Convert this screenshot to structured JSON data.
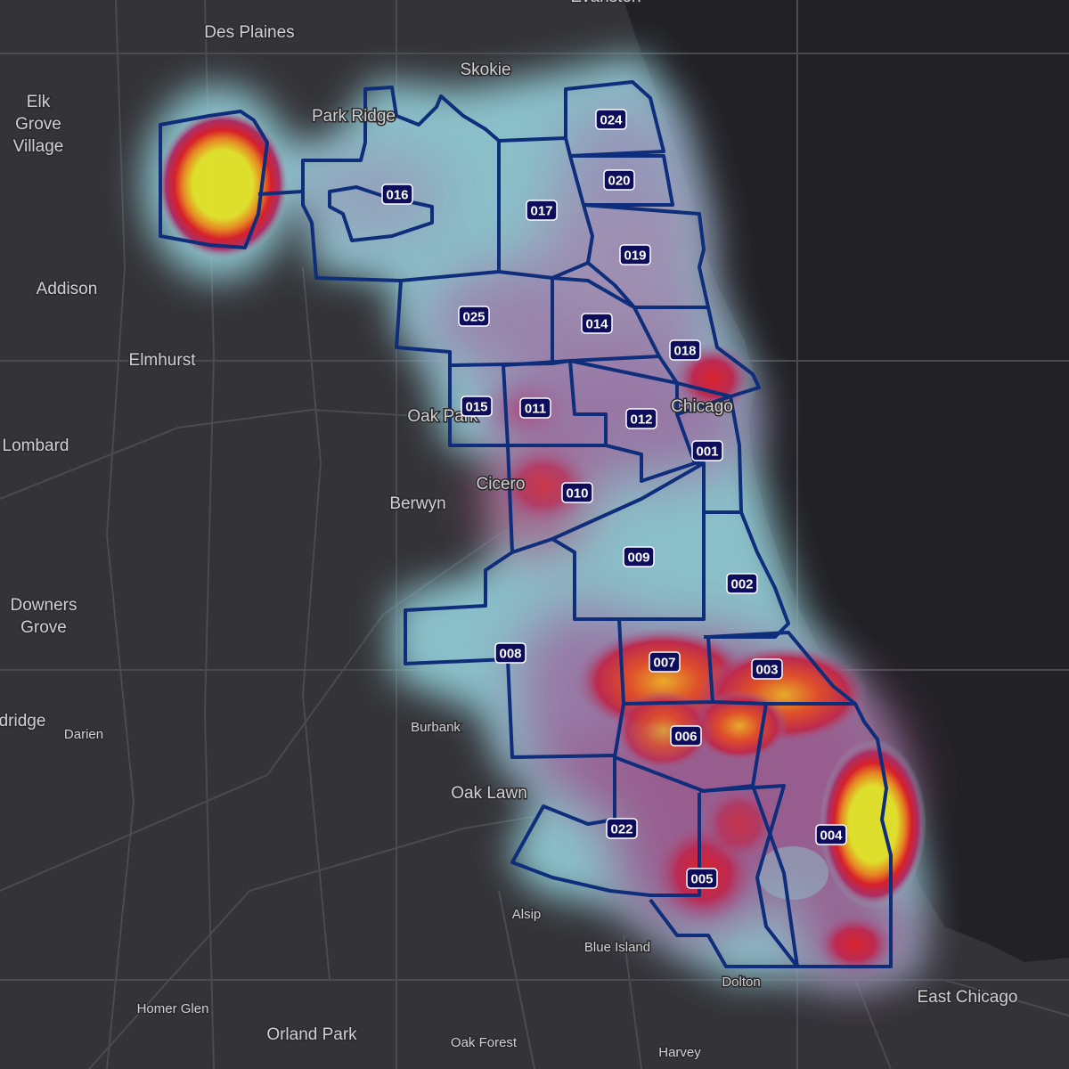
{
  "map": {
    "water_color": "#222226",
    "land_color": "#343438",
    "heat_base_color": "#8fc7d1",
    "heat_colors": [
      "#8fc7d1",
      "#9a6fa3",
      "#c0305a",
      "#e0202a",
      "#f5a020",
      "#e6e62a"
    ],
    "boundary_color": "#0e2d7a"
  },
  "places": [
    {
      "name": "Evanston"
    },
    {
      "name": "Des Plaines"
    },
    {
      "name": "Skokie"
    },
    {
      "name": "Elk\nGrove\nVillage"
    },
    {
      "name": "Park Ridge"
    },
    {
      "name": "Addison"
    },
    {
      "name": "Elmhurst"
    },
    {
      "name": "Oak Park"
    },
    {
      "name": "Chicago"
    },
    {
      "name": "Lombard"
    },
    {
      "name": "Cicero"
    },
    {
      "name": "Berwyn"
    },
    {
      "name": "Downers\nGrove"
    },
    {
      "name": "dridge"
    },
    {
      "name": "Darien"
    },
    {
      "name": "Burbank"
    },
    {
      "name": "Oak Lawn"
    },
    {
      "name": "Alsip"
    },
    {
      "name": "Blue Island"
    },
    {
      "name": "Dolton"
    },
    {
      "name": "East Chicago"
    },
    {
      "name": "Homer Glen"
    },
    {
      "name": "Orland Park"
    },
    {
      "name": "Oak Forest"
    },
    {
      "name": "Harvey"
    }
  ],
  "districts": [
    "024",
    "020",
    "016",
    "017",
    "019",
    "025",
    "014",
    "018",
    "015",
    "011",
    "012",
    "001",
    "010",
    "009",
    "002",
    "008",
    "007",
    "003",
    "006",
    "022",
    "004",
    "005"
  ]
}
